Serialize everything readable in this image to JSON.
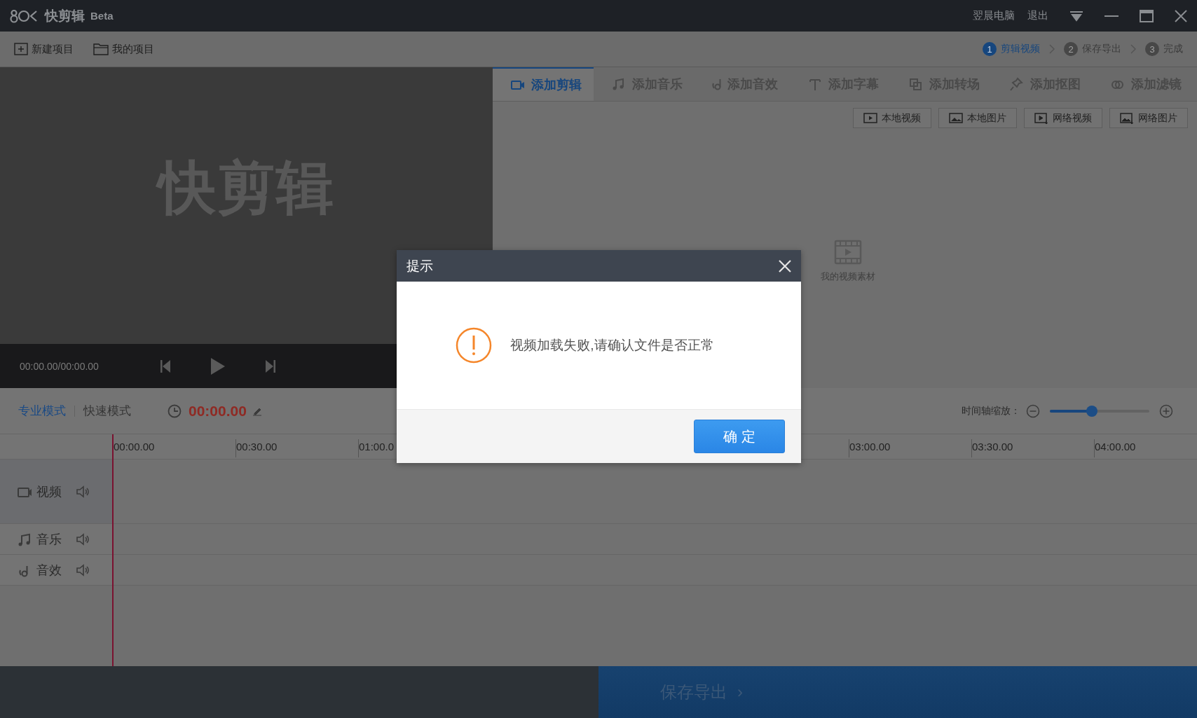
{
  "title_bar": {
    "app_name": "快剪辑",
    "badge": "Beta",
    "user": "翌晨电脑",
    "logout": "退出"
  },
  "toolbar": {
    "buttons": [
      "新建项目",
      "我的项目"
    ],
    "steps": [
      {
        "number": "1",
        "label": "剪辑视频",
        "selected": true
      },
      {
        "number": "2",
        "label": "保存导出",
        "selected": false
      },
      {
        "number": "3",
        "label": "完成",
        "selected": false
      }
    ]
  },
  "preview": {
    "logo_text": "快剪辑",
    "time": "00:00.00/00:00.00"
  },
  "tabs": [
    {
      "label": "添加剪辑",
      "selected": true
    },
    {
      "label": "添加音乐",
      "selected": false
    },
    {
      "label": "添加音效",
      "selected": false
    },
    {
      "label": "添加字幕",
      "selected": false
    },
    {
      "label": "添加转场",
      "selected": false
    },
    {
      "label": "添加抠图",
      "selected": false
    },
    {
      "label": "添加滤镜",
      "selected": false
    }
  ],
  "source_buttons": [
    "本地视频",
    "本地图片",
    "网络视频",
    "网络图片"
  ],
  "empty_state": {
    "label": "我的视频素材"
  },
  "timeline": {
    "modes": [
      {
        "label": "专业模式",
        "selected": true
      },
      {
        "label": "快速模式",
        "selected": false
      }
    ],
    "time": "00:00.00",
    "zoom_label": "时间轴缩放：",
    "zoom": {
      "level": 0.42
    },
    "ticks_left": [
      "00:00.00",
      "00:30.00",
      "01:00.0"
    ],
    "ticks_right": [
      "03:00.00",
      "03:30.00",
      "04:00.00"
    ],
    "tracks": [
      {
        "kind": "video",
        "label": "视频"
      },
      {
        "kind": "music",
        "label": "音乐"
      },
      {
        "kind": "sfx",
        "label": "音效"
      }
    ]
  },
  "footer": {
    "export": "保存导出",
    "arrow": "›"
  },
  "dialog": {
    "title": "提示",
    "message": "视频加载失败,请确认文件是否正常",
    "ok": "确 定"
  }
}
